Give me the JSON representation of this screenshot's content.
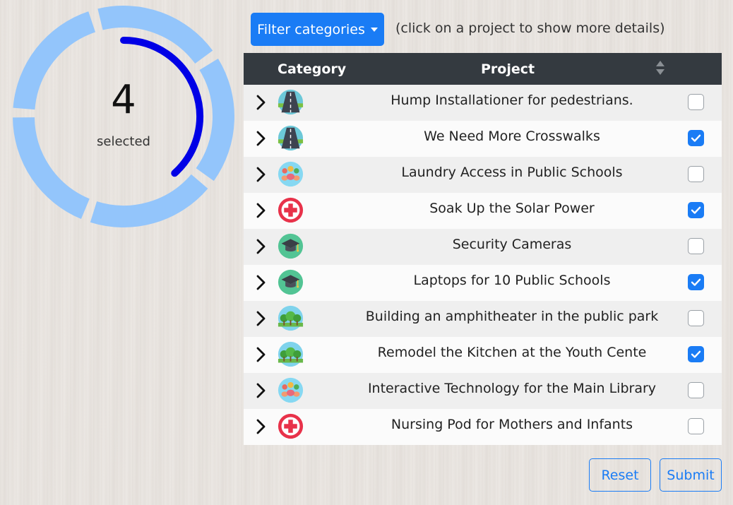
{
  "summary": {
    "count": "4",
    "label": "selected",
    "selected_fraction": 0.4
  },
  "toolbar": {
    "filter_label": "Filter categories",
    "hint": "(click on a project to show more details)"
  },
  "table": {
    "headers": {
      "category": "Category",
      "project": "Project"
    },
    "rows": [
      {
        "category_icon": "road-icon",
        "project": "Hump Installationer for pedestrians.",
        "selected": false
      },
      {
        "category_icon": "road-icon",
        "project": "We Need More Crosswalks",
        "selected": true
      },
      {
        "category_icon": "community-icon",
        "project": "Laundry Access in Public Schools",
        "selected": false
      },
      {
        "category_icon": "health-cross-icon",
        "project": "Soak Up the Solar Power",
        "selected": true
      },
      {
        "category_icon": "education-cap-icon",
        "project": "Security Cameras",
        "selected": false
      },
      {
        "category_icon": "education-cap-icon",
        "project": "Laptops for 10 Public Schools",
        "selected": true
      },
      {
        "category_icon": "parks-trees-icon",
        "project": "Building an amphitheater in the public park",
        "selected": false
      },
      {
        "category_icon": "parks-trees-icon",
        "project": "Remodel the Kitchen at the Youth Cente",
        "selected": true
      },
      {
        "category_icon": "community-icon",
        "project": "Interactive Technology for the Main Library",
        "selected": false
      },
      {
        "category_icon": "health-cross-icon",
        "project": "Nursing Pod for Mothers and Infants",
        "selected": false
      }
    ]
  },
  "actions": {
    "reset_label": "Reset",
    "submit_label": "Submit"
  },
  "colors": {
    "accent": "#1a7cf5",
    "ring_light": "#93c5fb",
    "ring_progress": "#0000e6",
    "header_bg": "#343a40"
  }
}
